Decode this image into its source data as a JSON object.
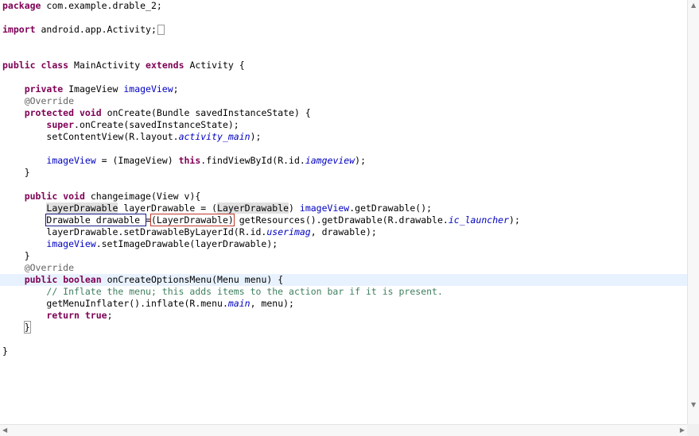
{
  "editor": {
    "lines": {
      "l1": {
        "kw": "package",
        "rest": " com.example.drable_2;"
      },
      "l2": {
        "kw": "import",
        "rest": " android.app.Activity;"
      },
      "l3": {
        "kw1": "public",
        "kw2": "class",
        "name": " MainActivity ",
        "kw3": "extends",
        "rest": " Activity {"
      },
      "l4": {
        "kw": "private",
        "type": " ImageView ",
        "field": "imageView",
        "rest": ";"
      },
      "l5": {
        "anno": "@Override"
      },
      "l6": {
        "kw1": "protected",
        "kw2": "void",
        "rest": " onCreate(Bundle savedInstanceState) {"
      },
      "l7": {
        "kw": "super",
        "rest": ".onCreate(savedInstanceState);"
      },
      "l8": {
        "pre": "setContentView(R.layout.",
        "sfield": "activity_main",
        "post": ");"
      },
      "l9": {
        "field": "imageView",
        "mid": " = (ImageView) ",
        "kw": "this",
        "pre2": ".findViewById(R.id.",
        "sfield": "iamgeview",
        "post": ");"
      },
      "l10": {
        "text": "}"
      },
      "l11": {
        "kw1": "public",
        "kw2": "void",
        "rest": " changeimage(View v){"
      },
      "l12": {
        "type": "LayerDrawable",
        "mid": " layerDrawable = (",
        "cast": "LayerDrawable",
        "mid2": ") ",
        "field": "imageView",
        "post": ".getDrawable();"
      },
      "l13": {
        "decl": "Drawable drawable ",
        "eq": "=",
        "cast": "(LayerDrawable)",
        "pre": " getResources().getDrawable(R.drawable.",
        "sfield": "ic_launcher",
        "post": ");"
      },
      "l14": {
        "pre": "layerDrawable.setDrawableByLayerId(R.id.",
        "sfield": "userimag",
        "post": ", drawable);"
      },
      "l15": {
        "field": "imageView",
        "post": ".setImageDrawable(layerDrawable);"
      },
      "l16": {
        "text": "}"
      },
      "l17": {
        "anno": "@Override"
      },
      "l18": {
        "kw1": "public",
        "kw2": "boolean",
        "rest": " onCreateOptionsMenu(Menu menu) {"
      },
      "l19": {
        "comment": "// Inflate the menu; this adds items to the action bar if it is present."
      },
      "l20": {
        "pre": "getMenuInflater().inflate(R.menu.",
        "sfield": "main",
        "post": ", menu);"
      },
      "l21": {
        "kw": "return",
        "kw2": "true",
        "post": ";"
      },
      "l22": {
        "text": "}"
      },
      "l23": {
        "text": "}"
      }
    }
  },
  "scrollbars": {
    "up_arrow": "▲",
    "down_arrow": "▼",
    "left_arrow": "◀",
    "right_arrow": "▶"
  }
}
